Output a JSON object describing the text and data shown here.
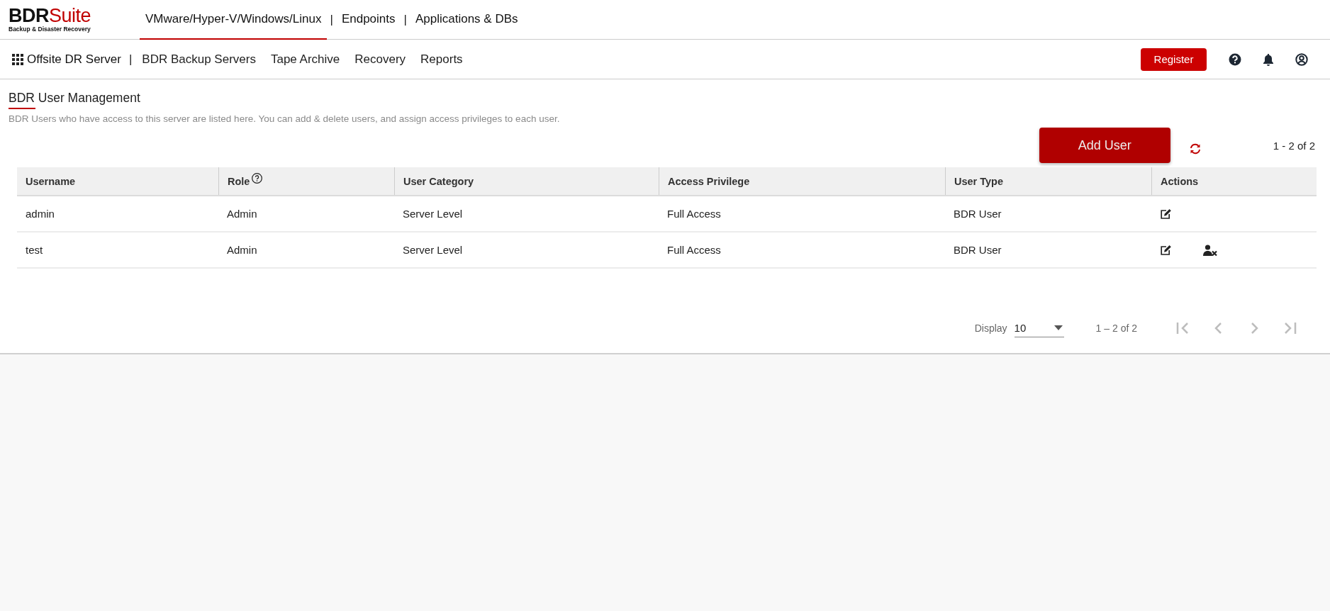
{
  "logo": {
    "name_parts": [
      "BDR",
      "Suite"
    ],
    "tagline": "Backup & Disaster Recovery"
  },
  "tab_divider": "|",
  "top_tabs": [
    {
      "label": "VMware/Hyper-V/Windows/Linux",
      "selected": true
    },
    {
      "label": "Endpoints",
      "selected": false
    },
    {
      "label": "Applications & DBs",
      "selected": false
    }
  ],
  "sub_nav": {
    "current": "Offsite DR Server",
    "divider": "|",
    "items": [
      {
        "label": "BDR Backup Servers"
      },
      {
        "label": "Tape Archive"
      },
      {
        "label": "Recovery"
      },
      {
        "label": "Reports"
      }
    ],
    "register_button": "Register"
  },
  "page": {
    "title": "BDR User Management",
    "description": "BDR Users who have access to this server are listed here. You can add & delete users, and assign access privileges to each user.",
    "add_button": "Add User",
    "range": "1 - 2 of 2"
  },
  "table": {
    "columns": [
      {
        "label": "Username",
        "help": false
      },
      {
        "label": "Role",
        "help": true
      },
      {
        "label": "User Category",
        "help": false
      },
      {
        "label": "Access Privilege",
        "help": false
      },
      {
        "label": "User Type",
        "help": false
      },
      {
        "label": "Actions",
        "help": false
      }
    ],
    "rows": [
      {
        "cells": [
          "admin",
          "Admin",
          "Server Level",
          "Full Access",
          "BDR User"
        ],
        "actions": [
          {
            "kind": "edit"
          }
        ]
      },
      {
        "cells": [
          "test",
          "Admin",
          "Server Level",
          "Full Access",
          "BDR User"
        ],
        "actions": [
          {
            "kind": "edit"
          },
          {
            "kind": "delete-user"
          }
        ]
      }
    ]
  },
  "pagination": {
    "display_label": "Display",
    "page_size": "10",
    "range": "1 – 2 of 2",
    "buttons": [
      {
        "kind": "first",
        "disabled": true
      },
      {
        "kind": "previous",
        "disabled": true
      },
      {
        "kind": "next",
        "disabled": true
      },
      {
        "kind": "last",
        "disabled": true
      }
    ]
  }
}
